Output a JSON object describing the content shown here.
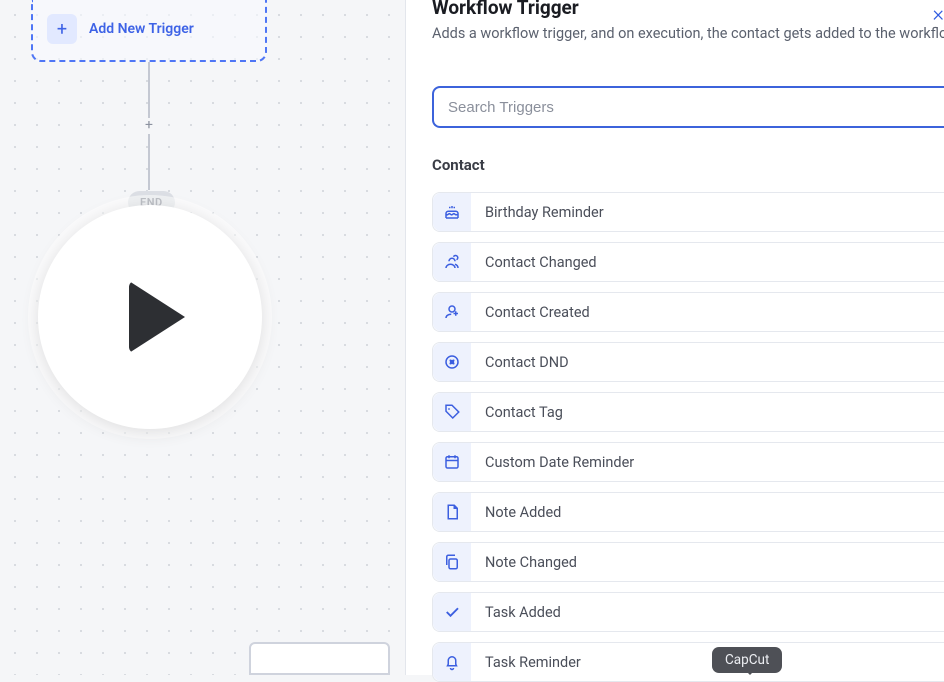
{
  "canvas": {
    "add_trigger_label": "Add New Trigger",
    "end_label": "END"
  },
  "panel": {
    "title": "Workflow Trigger",
    "description": "Adds a workflow trigger, and on execution, the contact gets added to the workflow",
    "search_placeholder": "Search Triggers",
    "section_label": "Contact",
    "triggers": [
      {
        "label": "Birthday Reminder",
        "icon": "cake-icon"
      },
      {
        "label": "Contact Changed",
        "icon": "users-icon"
      },
      {
        "label": "Contact Created",
        "icon": "user-plus-icon"
      },
      {
        "label": "Contact DND",
        "icon": "dnd-icon"
      },
      {
        "label": "Contact Tag",
        "icon": "tag-icon"
      },
      {
        "label": "Custom Date Reminder",
        "icon": "calendar-icon"
      },
      {
        "label": "Note Added",
        "icon": "file-icon"
      },
      {
        "label": "Note Changed",
        "icon": "copy-icon"
      },
      {
        "label": "Task Added",
        "icon": "check-icon"
      },
      {
        "label": "Task Reminder",
        "icon": "bell-icon"
      }
    ]
  },
  "overlay": {
    "capcut_label": "CapCut"
  }
}
